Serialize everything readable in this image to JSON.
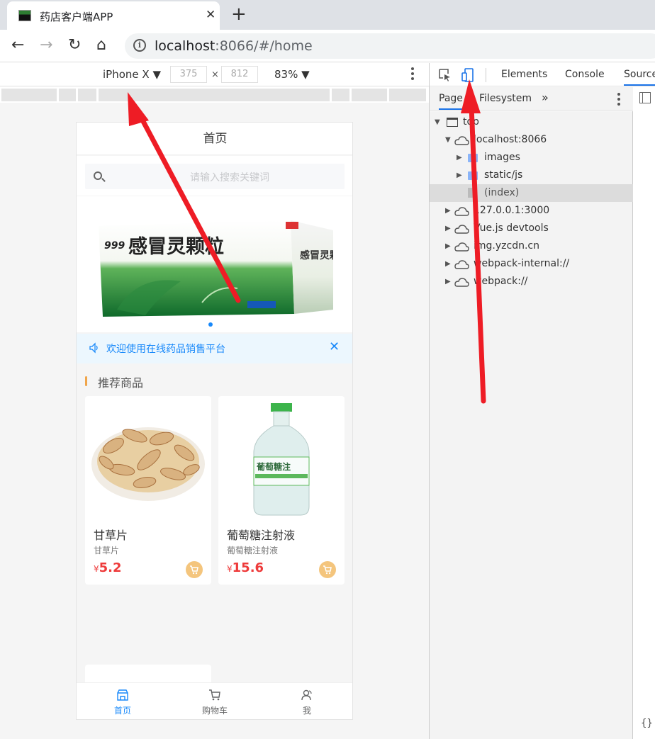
{
  "browser": {
    "tab_title": "药店客户端APP",
    "close_glyph": "✕",
    "new_tab_glyph": "+",
    "url_host": "localhost",
    "url_rest": ":8066/#/home",
    "back_glyph": "←",
    "forward_glyph": "→",
    "reload_glyph": "↻",
    "home_glyph": "⌂"
  },
  "device_toolbar": {
    "device": "iPhone X ▼",
    "width": "375",
    "height": "812",
    "times": "×",
    "zoom": "83% ▼"
  },
  "app": {
    "header_title": "首页",
    "search_placeholder": "请输入搜索关键词",
    "notice_text": "欢迎使用在线药品销售平台",
    "notice_close": "✕",
    "section_title": "推荐商品",
    "products": [
      {
        "name": "甘草片",
        "desc": "甘草片",
        "currency": "¥",
        "price": "5.2"
      },
      {
        "name": "葡萄糖注射液",
        "desc": "葡萄糖注射液",
        "currency": "¥",
        "price": "15.6"
      }
    ],
    "banner": {
      "brand": "999",
      "title": "感冒灵颗粒",
      "side_text": "感冒灵颗粒"
    },
    "bottle_label": "葡萄糖注",
    "tabbar": [
      {
        "label": "首页",
        "active": true,
        "icon": "shop-icon"
      },
      {
        "label": "购物车",
        "active": false,
        "icon": "cart-icon"
      },
      {
        "label": "我",
        "active": false,
        "icon": "user-icon"
      }
    ]
  },
  "devtools": {
    "tabs": [
      "Elements",
      "Console",
      "Source"
    ],
    "sub_tabs": [
      "Page",
      "Filesystem",
      "»"
    ],
    "tree": [
      {
        "label": "top"
      },
      {
        "label": "localhost:8066"
      },
      {
        "label": "images"
      },
      {
        "label": "static/js"
      },
      {
        "label": "(index)"
      },
      {
        "label": "127.0.0.1:3000"
      },
      {
        "label": "Vue.js devtools"
      },
      {
        "label": "img.yzcdn.cn"
      },
      {
        "label": "webpack-internal://"
      },
      {
        "label": "webpack://"
      }
    ],
    "braces": "{}"
  },
  "colors": {
    "accent": "#1989fa",
    "price": "#ee3b3b",
    "cart_button": "#f4c57d",
    "arrow": "#ee1c25"
  }
}
